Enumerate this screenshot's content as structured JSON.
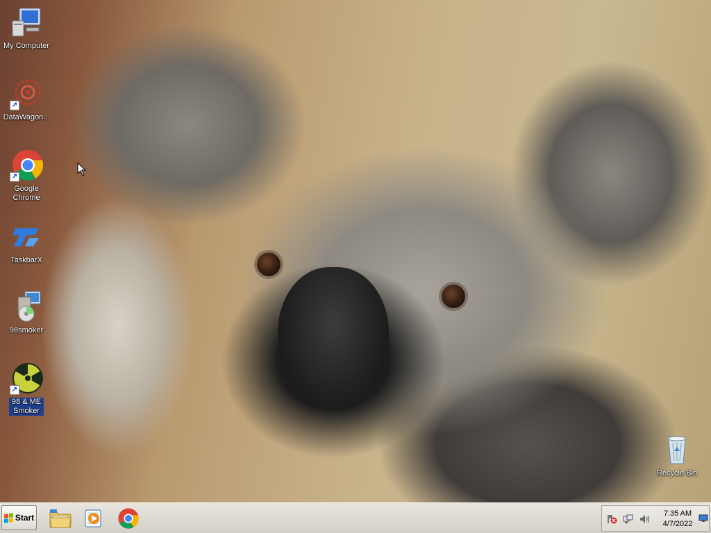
{
  "desktop": {
    "icons": [
      {
        "label": "My Computer",
        "icon": "computer-icon"
      },
      {
        "label": "DataWagon...",
        "icon": "datawagon-icon"
      },
      {
        "label": "Google Chrome",
        "icon": "chrome-icon"
      },
      {
        "label": "TaskbarX",
        "icon": "taskbarx-icon"
      },
      {
        "label": "98smoker",
        "icon": "installer-icon"
      },
      {
        "label": "98 & ME Smoker",
        "icon": "radiation-icon"
      },
      {
        "label": "Recycle Bin",
        "icon": "recycle-bin-icon"
      }
    ],
    "wallpaper": "koala"
  },
  "taskbar": {
    "start_label": "Start",
    "pinned": [
      {
        "name": "file-explorer",
        "icon": "folder-icon"
      },
      {
        "name": "media-player",
        "icon": "media-player-icon"
      },
      {
        "name": "chrome",
        "icon": "chrome-icon"
      }
    ],
    "tray": {
      "icons": [
        "action-center-icon",
        "network-icon",
        "volume-icon"
      ],
      "time": "7:35 AM",
      "date": "4/7/2022"
    }
  },
  "colors": {
    "taskbar_bg": "#d4d0c8",
    "selection": "#1f3f8f",
    "chrome_red": "#db4437",
    "chrome_green": "#0f9d58",
    "chrome_yellow": "#f4b400",
    "chrome_blue": "#4285f4"
  }
}
